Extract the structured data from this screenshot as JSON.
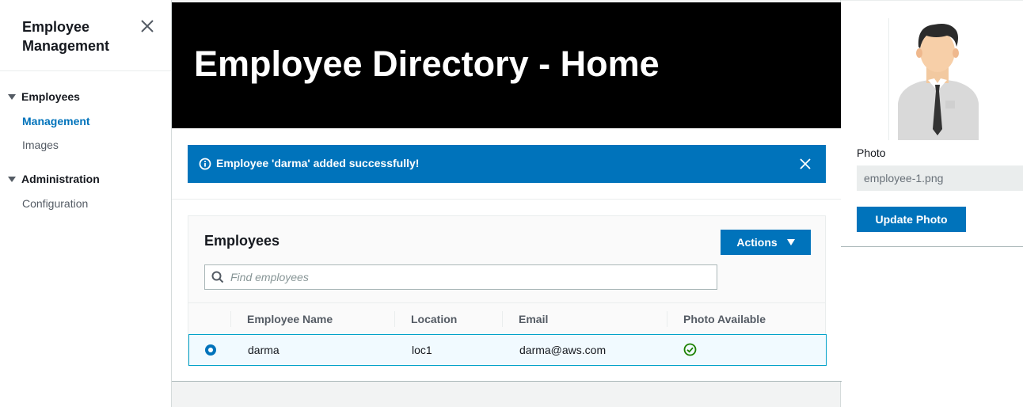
{
  "sidebar": {
    "title": "Employee Management",
    "sections": [
      {
        "label": "Employees",
        "links": [
          "Management",
          "Images"
        ]
      },
      {
        "label": "Administration",
        "links": [
          "Configuration"
        ]
      }
    ],
    "active_link": "Management"
  },
  "header": {
    "title": "Employee Directory - Home"
  },
  "flash": {
    "message": "Employee 'darma' added successfully!",
    "color": "#0073bb"
  },
  "employees_panel": {
    "title": "Employees",
    "actions_label": "Actions",
    "search_placeholder": "Find employees",
    "columns": [
      "Employee Name",
      "Location",
      "Email",
      "Photo Available"
    ],
    "rows": [
      {
        "name": "darma",
        "location": "loc1",
        "email": "darma@aws.com",
        "photo_available": true,
        "selected": true
      }
    ]
  },
  "details_panel": {
    "photo_label": "Photo",
    "photo_value": "employee-1.png",
    "update_label": "Update Photo"
  },
  "colors": {
    "accent": "#0073bb",
    "success": "#1d8102",
    "header_bg": "#000000"
  },
  "icons": [
    "close-icon",
    "info-icon",
    "search-icon",
    "caret-down-icon",
    "check-circle-icon",
    "avatar-image"
  ]
}
